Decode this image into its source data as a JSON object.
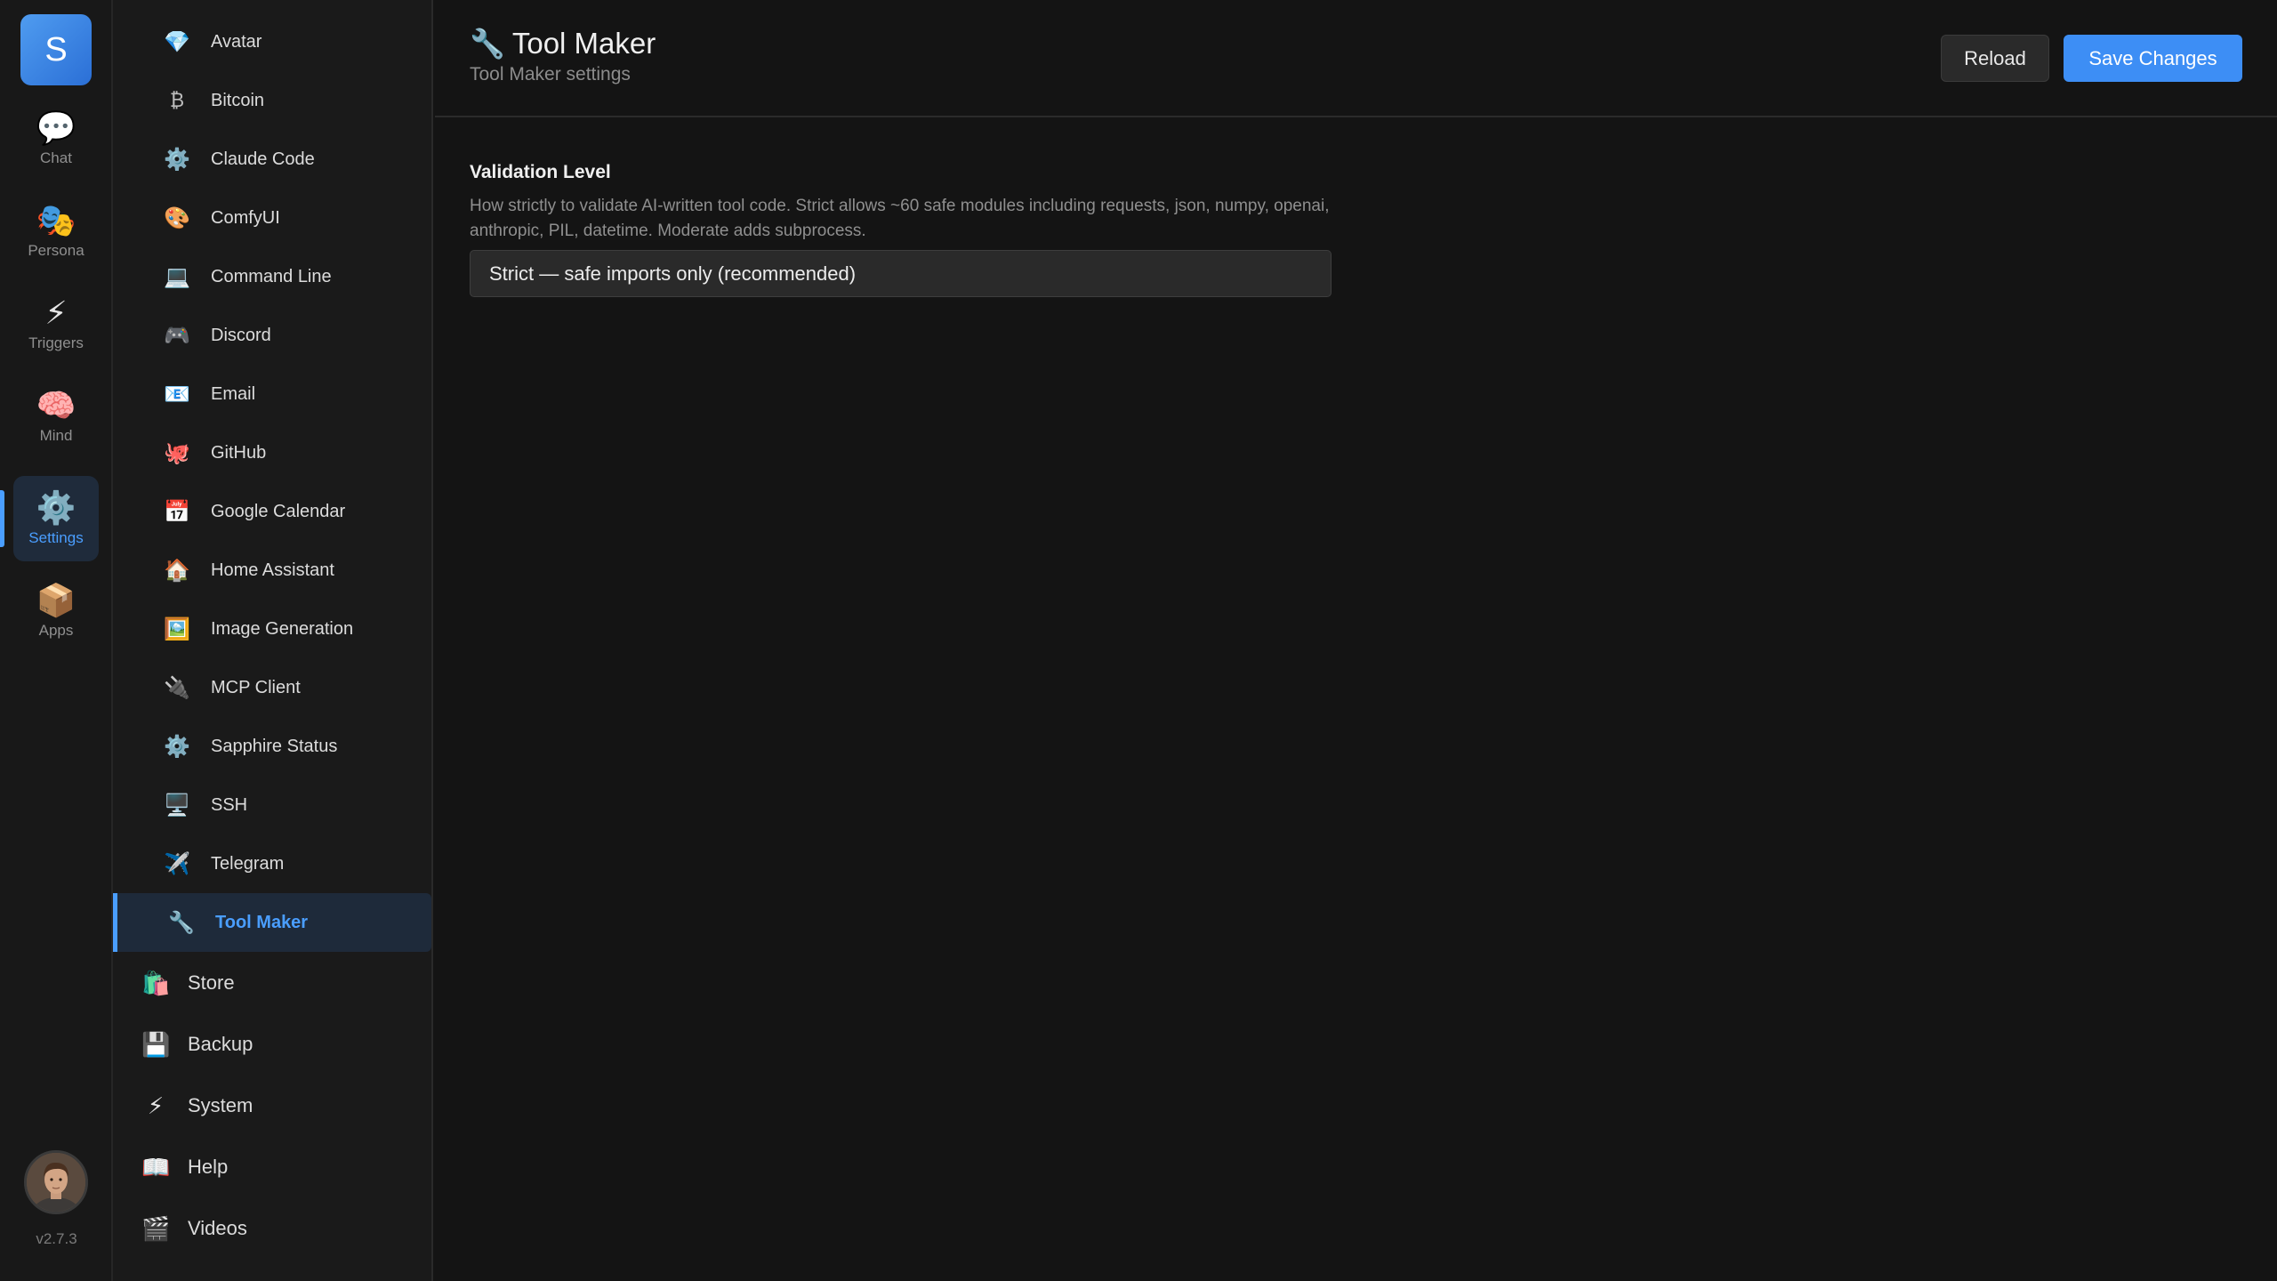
{
  "rail": {
    "logo": "S",
    "items": [
      {
        "icon": "💬",
        "icon_name": "chat-icon",
        "label": "Chat"
      },
      {
        "icon": "🎭",
        "icon_name": "persona-icon",
        "label": "Persona"
      },
      {
        "icon": "⚡",
        "icon_name": "lightning-icon",
        "label": "Triggers"
      },
      {
        "icon": "🧠",
        "icon_name": "brain-icon",
        "label": "Mind"
      },
      {
        "icon": "⚙️",
        "icon_name": "gear-icon",
        "label": "Settings"
      },
      {
        "icon": "📦",
        "icon_name": "package-icon",
        "label": "Apps"
      }
    ],
    "active_item": "Settings",
    "version": "v2.7.3"
  },
  "sidebar": {
    "plugins": [
      {
        "icon": "💎",
        "icon_name": "gem-icon",
        "label": "Avatar"
      },
      {
        "icon": "₿",
        "icon_name": "bitcoin-icon",
        "label": "Bitcoin"
      },
      {
        "icon": "⚙️",
        "icon_name": "gear-icon",
        "label": "Claude Code"
      },
      {
        "icon": "🎨",
        "icon_name": "palette-icon",
        "label": "ComfyUI"
      },
      {
        "icon": "💻",
        "icon_name": "laptop-icon",
        "label": "Command Line"
      },
      {
        "icon": "🎮",
        "icon_name": "gamepad-icon",
        "label": "Discord"
      },
      {
        "icon": "📧",
        "icon_name": "email-icon",
        "label": "Email"
      },
      {
        "icon": "🐙",
        "icon_name": "octopus-icon",
        "label": "GitHub"
      },
      {
        "icon": "📅",
        "icon_name": "calendar-icon",
        "label": "Google Calendar"
      },
      {
        "icon": "🏠",
        "icon_name": "house-icon",
        "label": "Home Assistant"
      },
      {
        "icon": "🖼️",
        "icon_name": "picture-icon",
        "label": "Image Generation"
      },
      {
        "icon": "🔌",
        "icon_name": "plug-icon",
        "label": "MCP Client"
      },
      {
        "icon": "⚙️",
        "icon_name": "gear-icon",
        "label": "Sapphire Status"
      },
      {
        "icon": "🖥️",
        "icon_name": "desktop-icon",
        "label": "SSH"
      },
      {
        "icon": "✈️",
        "icon_name": "airplane-icon",
        "label": "Telegram"
      },
      {
        "icon": "🔧",
        "icon_name": "wrench-icon",
        "label": "Tool Maker"
      }
    ],
    "active_plugin": "Tool Maker",
    "sections": [
      {
        "icon": "🛍️",
        "icon_name": "shopping-bags-icon",
        "label": "Store"
      },
      {
        "icon": "💾",
        "icon_name": "floppy-disk-icon",
        "label": "Backup"
      },
      {
        "icon": "⚡",
        "icon_name": "lightning-icon",
        "label": "System"
      },
      {
        "icon": "📖",
        "icon_name": "book-icon",
        "label": "Help"
      },
      {
        "icon": "🎬",
        "icon_name": "clapper-icon",
        "label": "Videos"
      }
    ]
  },
  "header": {
    "title_icon": "🔧",
    "title": "Tool Maker",
    "subtitle": "Tool Maker settings",
    "reload_label": "Reload",
    "save_label": "Save Changes"
  },
  "form": {
    "label": "Validation Level",
    "description": "How strictly to validate AI-written tool code. Strict allows ~60 safe modules including requests, json, numpy, openai, anthropic, PIL, datetime. Moderate adds subprocess.",
    "selected_value": "Strict — safe imports only (recommended)"
  },
  "colors": {
    "accent": "#4a9eff",
    "save_button": "#3d8ef5",
    "background": "#141414",
    "sidebar_bg": "#1a1a1a"
  }
}
